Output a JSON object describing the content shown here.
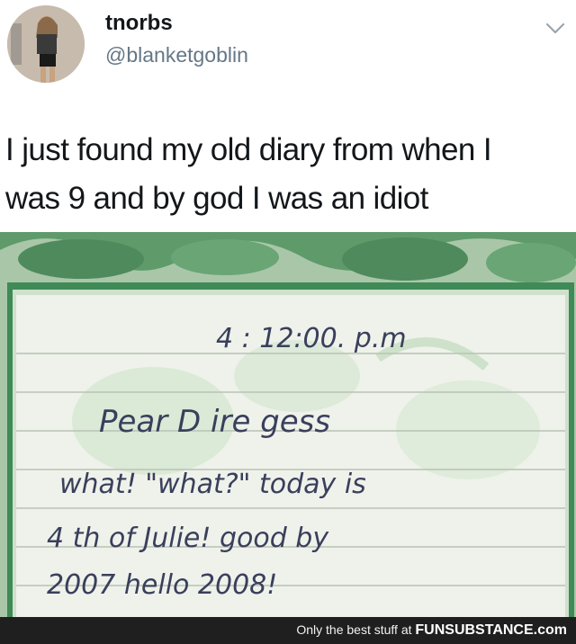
{
  "tweet": {
    "display_name": "tnorbs",
    "handle": "@blanketgoblin",
    "text_line1": "I just found my old diary from when I",
    "text_line2": "was 9 and by god I was an idiot",
    "menu_icon": "chevron-down-icon"
  },
  "diary": {
    "time": "4 : 12:00. p.m",
    "line1": "Pear D ire gess",
    "line2": "what! \"what?\" today is",
    "line3": "4 th of Julie! good by",
    "line4": "2007 hello 2008!"
  },
  "footer": {
    "prefix": "Only the best stuff at",
    "brand": "FUNSUBSTANCE.com"
  },
  "colors": {
    "paper_green": "#5f9a6a",
    "ink": "#3a3f5c",
    "footer_bg": "#1f1f1f"
  }
}
